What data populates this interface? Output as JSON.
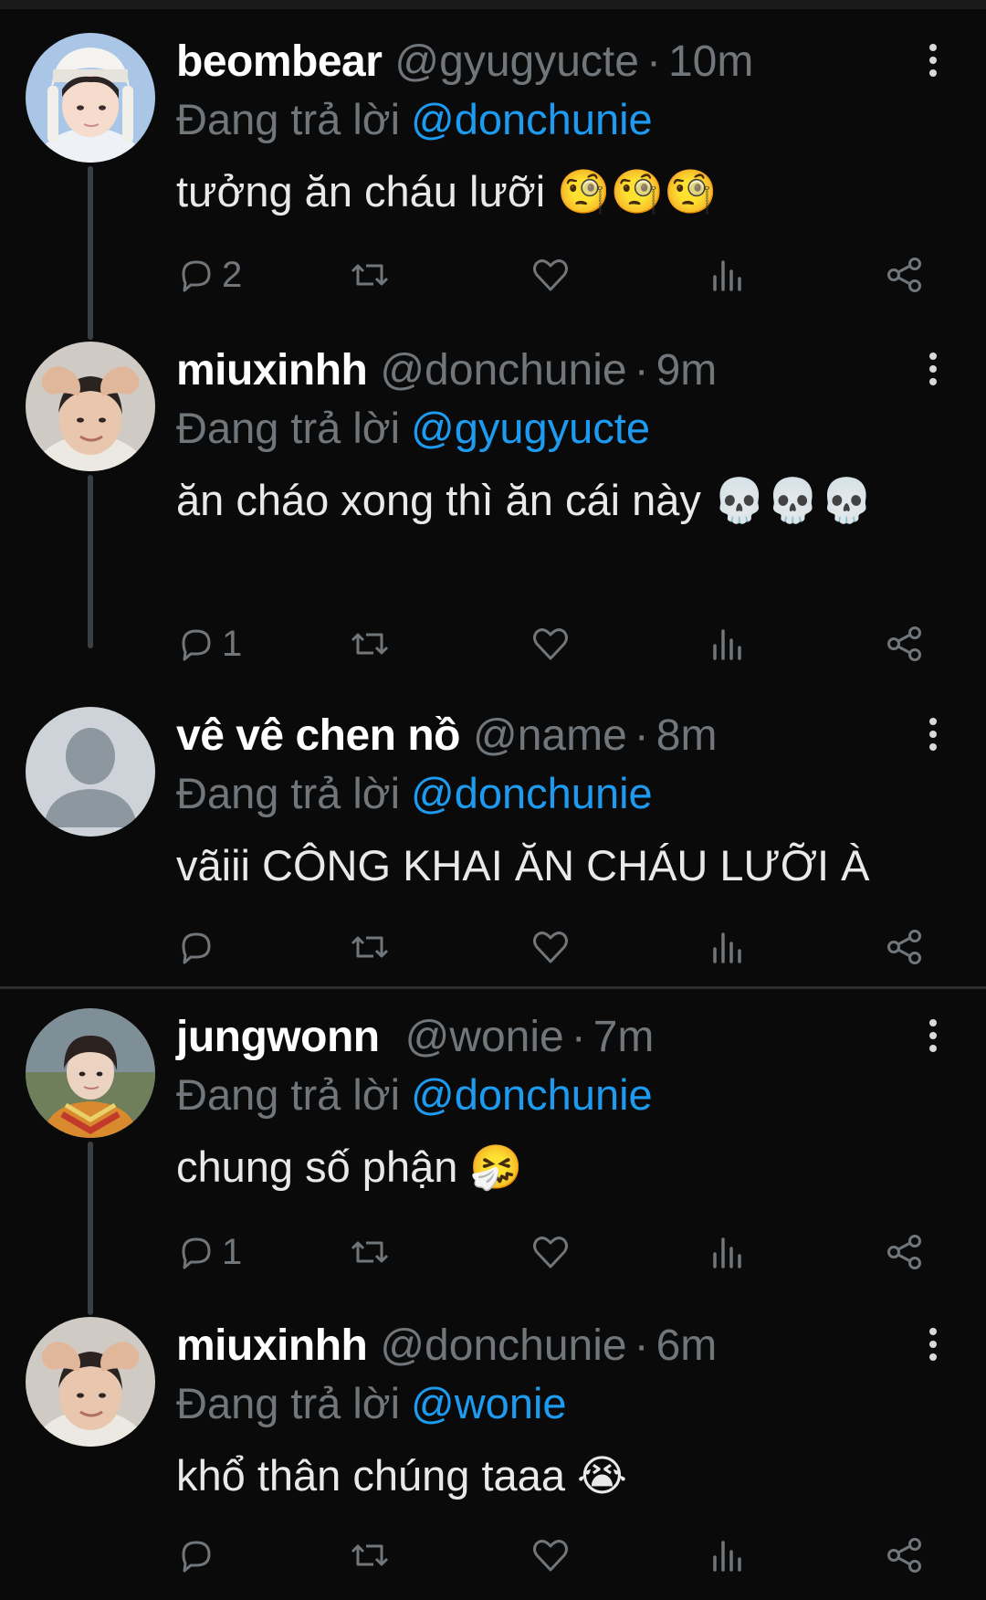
{
  "tweets": [
    {
      "name": "beombear",
      "handle": "@gyugyucte",
      "separator": "·",
      "time": "10m",
      "reply_label": "Đang trả lời",
      "reply_to": "@donchunie",
      "text": "tưởng ăn cháu lưỡi 🧐🧐🧐",
      "reply_count": "2",
      "avatar": "user-photo-beanie"
    },
    {
      "name": "miuxinhh",
      "handle": "@donchunie",
      "separator": "·",
      "time": "9m",
      "reply_label": "Đang trả lời",
      "reply_to": "@gyugyucte",
      "text": "ăn cháo xong thì ăn cái này 💀💀💀",
      "reply_count": "1",
      "avatar": "user-photo-heart-hands"
    },
    {
      "name": "vê vê chen nồ",
      "handle": "@name",
      "separator": "·",
      "time": "8m",
      "reply_label": "Đang trả lời",
      "reply_to": "@donchunie",
      "text": "vãiii CÔNG KHAI ĂN CHÁU LƯỠI À",
      "reply_count": "",
      "avatar": "default-avatar"
    },
    {
      "name": "jungwonn",
      "handle": "@wonie",
      "separator": "·",
      "time": "7m",
      "reply_label": "Đang trả lời",
      "reply_to": "@donchunie",
      "text": "chung số phận 🤧",
      "reply_count": "1",
      "avatar": "user-photo-outdoor"
    },
    {
      "name": "miuxinhh",
      "handle": "@donchunie",
      "separator": "·",
      "time": "6m",
      "reply_label": "Đang trả lời",
      "reply_to": "@wonie",
      "text": "khổ thân chúng taaa 😭",
      "reply_count": "",
      "avatar": "user-photo-heart-hands"
    }
  ],
  "icons": {
    "reply": "reply-icon",
    "retweet": "retweet-icon",
    "like": "like-icon",
    "views": "views-icon",
    "share": "share-icon",
    "more": "more-vertical-icon"
  },
  "colors": {
    "background": "#0a0a0a",
    "name": "#ffffff",
    "secondary": "#71767b",
    "link": "#1d9bf0",
    "thread_line": "#3a3f44"
  }
}
